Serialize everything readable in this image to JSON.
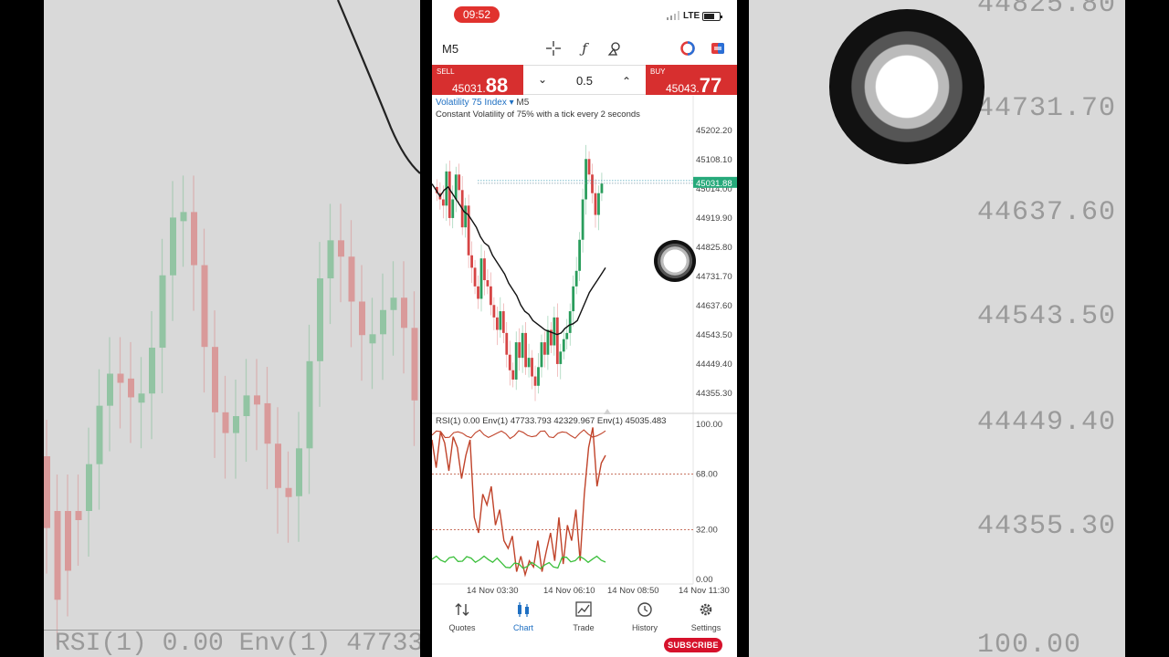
{
  "status_bar": {
    "time": "09:52",
    "network": "LTE"
  },
  "toolbar": {
    "timeframe": "M5",
    "icons": [
      "crosshair-icon",
      "indicator-f-icon",
      "objects-icon",
      "account-icon",
      "trade-icon"
    ]
  },
  "trade": {
    "sell_label": "SELL",
    "sell_price_main": "45031.",
    "sell_price_big": "88",
    "buy_label": "BUY",
    "buy_price_main": "45043.",
    "buy_price_big": "77",
    "lot_value": "0.5"
  },
  "chart": {
    "symbol": "Volatility 75 Index",
    "timeframe": "M5",
    "description": "Constant Volatility of 75% with a tick every 2 seconds",
    "price_ticks": [
      "45202.20",
      "45108.10",
      "45014.00",
      "44919.90",
      "44825.80",
      "44731.70",
      "44637.60",
      "44543.50",
      "44449.40",
      "44355.30"
    ],
    "current_price_label": "45031.88",
    "rsi_header": "RSI(1) 0.00 Env(1) 47733.793 42329.967 Env(1) 45035.483",
    "rsi_ticks": [
      "100.00",
      "68.00",
      "32.00",
      "0.00"
    ],
    "time_labels": [
      "14 Nov 03:30",
      "14 Nov 06:10",
      "14 Nov 08:50",
      "14 Nov 11:30"
    ],
    "colors": {
      "bull": "#2a9d5c",
      "bear": "#d64545",
      "ma": "#111111",
      "rsi": "#c0432a",
      "env": "#3bbf3b"
    }
  },
  "chart_data": {
    "type": "candlestick",
    "title": "Volatility 75 Index",
    "ylim": [
      44300,
      45240
    ],
    "close_series": [
      45000,
      44980,
      44960,
      45070,
      44920,
      44980,
      45060,
      45010,
      44890,
      44960,
      44800,
      44760,
      44700,
      44660,
      44790,
      44720,
      44700,
      44640,
      44600,
      44560,
      44620,
      44550,
      44480,
      44430,
      44400,
      44520,
      44470,
      44550,
      44440,
      44470,
      44410,
      44380,
      44440,
      44520,
      44480,
      44560,
      44510,
      44600,
      44450,
      44490,
      44530,
      44550,
      44620,
      44700,
      44750,
      44850,
      44980,
      45110,
      45060,
      45000,
      44930,
      45000,
      45031
    ],
    "ma_series": [
      45030,
      45010,
      44990,
      45010,
      45020,
      45000,
      44980,
      44960,
      44940,
      44930,
      44910,
      44890,
      44860,
      44840,
      44830,
      44800,
      44780,
      44760,
      44740,
      44710,
      44690,
      44670,
      44640,
      44620,
      44610,
      44590,
      44580,
      44570,
      44560,
      44555,
      44550,
      44545,
      44550,
      44565,
      44575,
      44580,
      44590,
      44620,
      44650,
      44680,
      44700,
      44720,
      44740,
      44760
    ],
    "rsi_series": [
      90,
      72,
      95,
      88,
      70,
      92,
      85,
      65,
      80,
      90,
      40,
      30,
      55,
      48,
      60,
      35,
      45,
      25,
      20,
      28,
      5,
      15,
      3,
      12,
      8,
      25,
      5,
      18,
      30,
      12,
      40,
      10,
      35,
      25,
      45,
      12,
      55,
      85,
      98,
      60,
      75,
      80
    ],
    "env_upper": 93,
    "env_lower": 18
  }
}
